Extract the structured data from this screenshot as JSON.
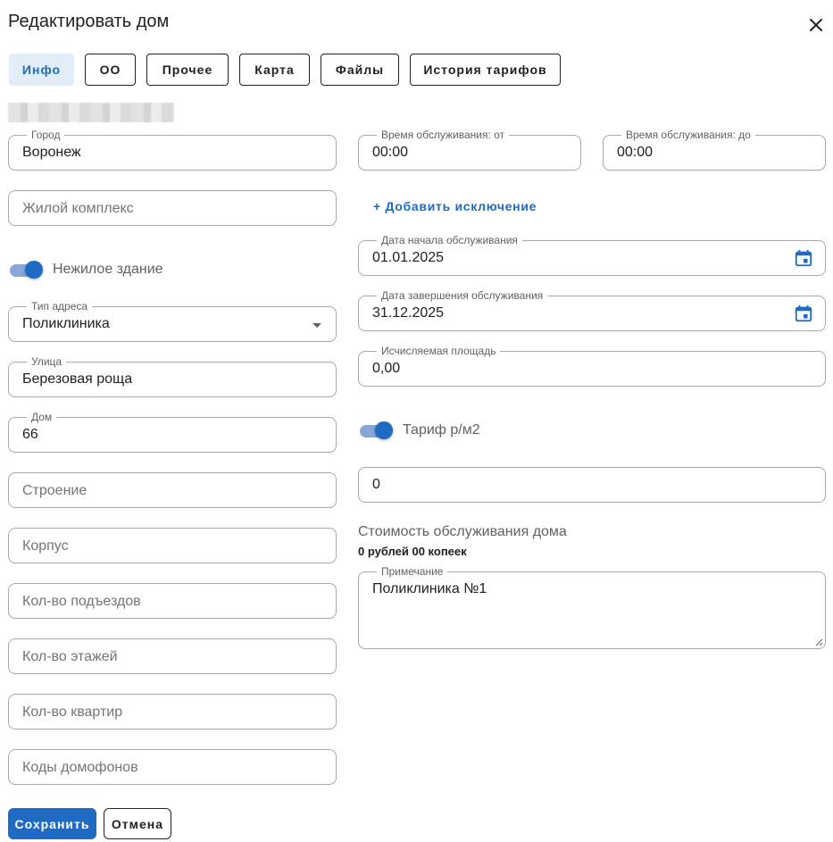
{
  "dialog": {
    "title": "Редактировать дом"
  },
  "tabs": [
    {
      "label": "Инфо",
      "active": true
    },
    {
      "label": "ОО"
    },
    {
      "label": "Прочее"
    },
    {
      "label": "Карта"
    },
    {
      "label": "Файлы"
    },
    {
      "label": "История тарифов"
    }
  ],
  "left": {
    "city": {
      "label": "Город",
      "value": "Воронеж"
    },
    "complex": {
      "placeholder": "Жилой комплекс"
    },
    "nonresidential": {
      "label": "Нежилое здание",
      "on": true
    },
    "address_type": {
      "label": "Тип адреса",
      "value": "Поликлиника"
    },
    "street": {
      "label": "Улица",
      "value": "Березовая роща"
    },
    "house": {
      "label": "Дом",
      "value": "66"
    },
    "building": {
      "placeholder": "Строение"
    },
    "corpus": {
      "placeholder": "Корпус"
    },
    "entrances": {
      "placeholder": "Кол-во подъездов"
    },
    "floors": {
      "placeholder": "Кол-во этажей"
    },
    "apartments": {
      "placeholder": "Кол-во квартир"
    },
    "intercom": {
      "placeholder": "Коды домофонов"
    }
  },
  "right": {
    "time_from": {
      "label": "Время обслуживания: от",
      "value": "00:00"
    },
    "time_to": {
      "label": "Время обслуживания: до",
      "value": "00:00"
    },
    "add_exception": "+ Добавить исключение",
    "start_date": {
      "label": "Дата начала обслуживания",
      "value": "01.01.2025"
    },
    "end_date": {
      "label": "Дата завершения обслуживания",
      "value": "31.12.2025"
    },
    "area": {
      "label": "Исчисляемая площадь",
      "value": "0,00"
    },
    "tariff": {
      "label": "Тариф р/м2",
      "on": true
    },
    "tariff_value": "0",
    "cost_title": "Стоимость обслуживания дома",
    "cost_value": "0 рублей 00 копеек",
    "note": {
      "label": "Примечание",
      "value": "Поликлиника №1"
    }
  },
  "actions": {
    "save": "Сохранить",
    "cancel": "Отмена"
  },
  "colors": {
    "accent": "#1f6ac2",
    "switch_track": "#86a8d8",
    "tab_active_bg": "#e3edf8",
    "border": "#a9a9a9"
  },
  "icons": [
    "close-icon",
    "chevron-down-icon",
    "calendar-icon",
    "resize-handle-icon"
  ]
}
